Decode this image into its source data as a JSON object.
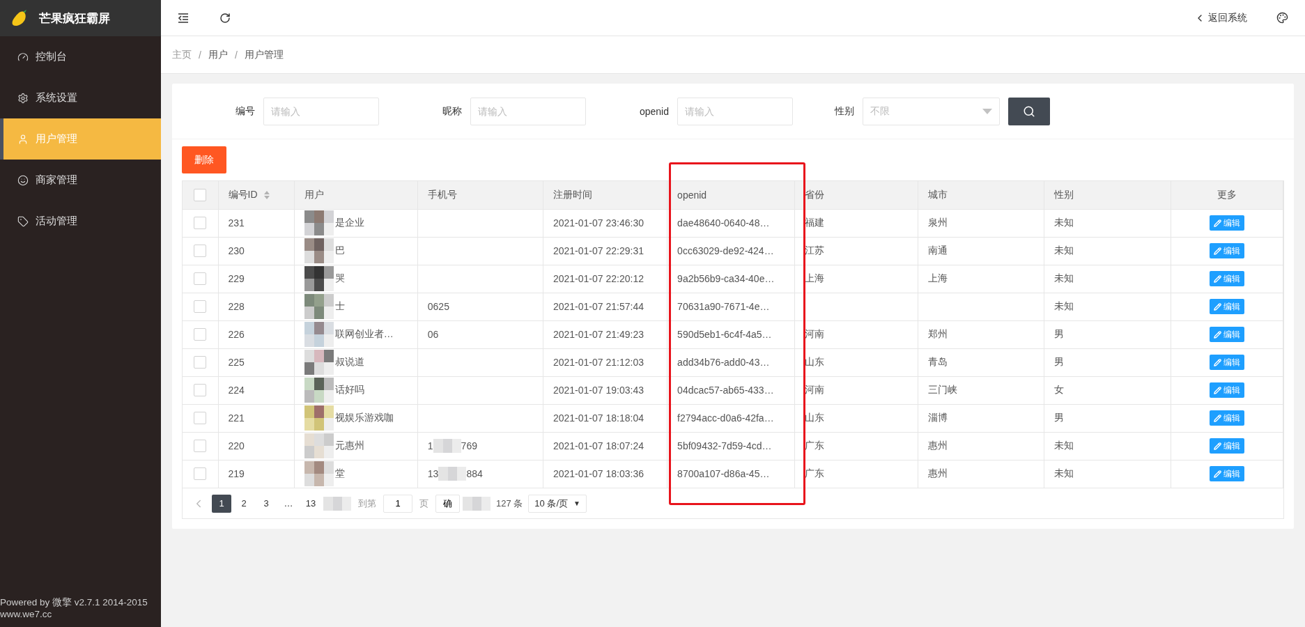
{
  "brand": {
    "title": "芒果疯狂霸屏"
  },
  "sidebar": {
    "items": [
      {
        "label": "控制台",
        "selected": false
      },
      {
        "label": "系统设置",
        "selected": false
      },
      {
        "label": "用户管理",
        "selected": true
      },
      {
        "label": "商家管理",
        "selected": false
      },
      {
        "label": "活动管理",
        "selected": false
      }
    ],
    "footer": [
      "Powered by 微擎 v2.7.1 2014-2015",
      "www.we7.cc"
    ]
  },
  "header": {
    "back_link": "返回系统"
  },
  "breadcrumb": [
    {
      "kind": "link",
      "text": "主页"
    },
    {
      "kind": "separator",
      "text": "/"
    },
    {
      "kind": "link",
      "text": "用户"
    },
    {
      "kind": "separator",
      "text": "/"
    },
    {
      "kind": "link",
      "text": "用户管理"
    }
  ],
  "filters": [
    {
      "kind": "input",
      "label": "编号",
      "placeholder": "请输入"
    },
    {
      "kind": "input",
      "label": "昵称",
      "placeholder": "请输入"
    },
    {
      "kind": "input",
      "label": "openid",
      "placeholder": "请输入"
    },
    {
      "kind": "select",
      "label": "性别",
      "placeholder": "不限"
    }
  ],
  "delete_button": "删除",
  "table": {
    "select_all_checked": false,
    "columns": [
      "编号ID",
      "用户",
      "手机号",
      "注册时间",
      "openid",
      "省份",
      "城市",
      "性别",
      "更多"
    ],
    "rows": [
      {
        "checked": false,
        "id": "231",
        "user": "是企业",
        "phone": [],
        "time": "2021-01-07 23:46:30",
        "openid": "dae48640-0640-48…",
        "province": "福建",
        "city": "泉州",
        "gender": "未知",
        "action": "编辑"
      },
      {
        "checked": false,
        "id": "230",
        "user": "巴",
        "phone": [],
        "time": "2021-01-07 22:29:31",
        "openid": "0cc63029-de92-424…",
        "province": "江苏",
        "city": "南通",
        "gender": "未知",
        "action": "编辑"
      },
      {
        "checked": false,
        "id": "229",
        "user": "哭",
        "phone": [],
        "time": "2021-01-07 22:20:12",
        "openid": "9a2b56b9-ca34-40e…",
        "province": "上海",
        "city": "上海",
        "gender": "未知",
        "action": "编辑"
      },
      {
        "checked": false,
        "id": "228",
        "user": "士",
        "phone": [
          "0625"
        ],
        "time": "2021-01-07 21:57:44",
        "openid": "70631a90-7671-4e…",
        "province": "",
        "city": "",
        "gender": "未知",
        "action": "编辑"
      },
      {
        "checked": false,
        "id": "226",
        "user": "联网创业者…",
        "phone": [
          "06"
        ],
        "time": "2021-01-07 21:49:23",
        "openid": "590d5eb1-6c4f-4a5…",
        "province": "河南",
        "city": "郑州",
        "gender": "男",
        "action": "编辑"
      },
      {
        "checked": false,
        "id": "225",
        "user": "叔说道",
        "phone": [],
        "time": "2021-01-07 21:12:03",
        "openid": "add34b76-add0-43…",
        "province": "山东",
        "city": "青岛",
        "gender": "男",
        "action": "编辑"
      },
      {
        "checked": false,
        "id": "224",
        "user": "话好吗",
        "phone": [],
        "time": "2021-01-07 19:03:43",
        "openid": "04dcac57-ab65-433…",
        "province": "河南",
        "city": "三门峡",
        "gender": "女",
        "action": "编辑"
      },
      {
        "checked": false,
        "id": "221",
        "user": "视娱乐游戏咖",
        "phone": [],
        "time": "2021-01-07 18:18:04",
        "openid": "f2794acc-d0a6-42fa…",
        "province": "山东",
        "city": "淄博",
        "gender": "男",
        "action": "编辑"
      },
      {
        "checked": false,
        "id": "220",
        "user": "元惠州",
        "phone": [
          "1",
          "769"
        ],
        "time": "2021-01-07 18:07:24",
        "openid": "5bf09432-7d59-4cd…",
        "province": "广东",
        "city": "惠州",
        "gender": "未知",
        "action": "编辑"
      },
      {
        "checked": false,
        "id": "219",
        "user": "堂",
        "phone": [
          "13",
          "884"
        ],
        "time": "2021-01-07 18:03:36",
        "openid": "8700a107-d86a-45…",
        "province": "广东",
        "city": "惠州",
        "gender": "未知",
        "action": "编辑"
      }
    ]
  },
  "pagination": {
    "pages": [
      {
        "label": "1",
        "selected": true
      },
      {
        "label": "2",
        "selected": false
      },
      {
        "label": "3",
        "selected": false
      },
      {
        "label": "…",
        "selected": false
      },
      {
        "label": "13",
        "selected": false
      }
    ],
    "goto_label": "到第",
    "goto_value": "1",
    "page_unit": "页",
    "confirm": "确",
    "total": "127 条",
    "page_size": "10 条/页",
    "page_size_arrow": "▼"
  }
}
